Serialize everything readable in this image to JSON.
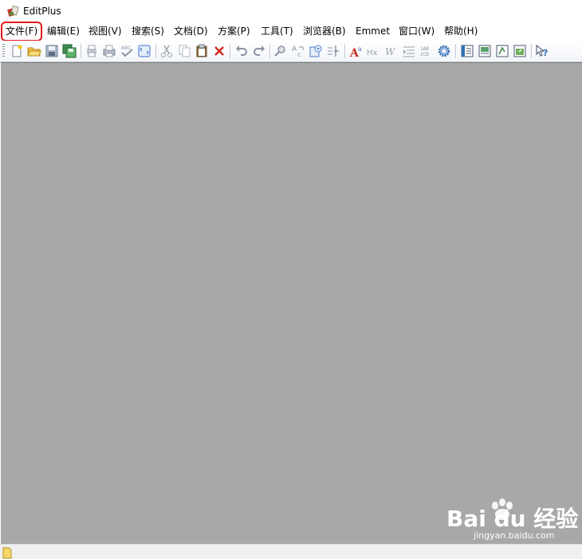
{
  "window": {
    "title": "EditPlus"
  },
  "menu": {
    "items": [
      {
        "label": "文件(F)"
      },
      {
        "label": "编辑(E)"
      },
      {
        "label": "视图(V)"
      },
      {
        "label": "搜索(S)"
      },
      {
        "label": "文档(D)"
      },
      {
        "label": "方案(P)"
      },
      {
        "label": "工具(T)"
      },
      {
        "label": "浏览器(B)"
      },
      {
        "label": "Emmet"
      },
      {
        "label": "窗口(W)"
      },
      {
        "label": "帮助(H)"
      }
    ],
    "highlighted_index": 0,
    "highlight_color": "#e21b1b"
  },
  "toolbar": {
    "buttons": [
      "new-file-icon",
      "open-folder-icon",
      "save-icon",
      "save-all-icon",
      "print-preview-icon",
      "print-icon",
      "spell-check-icon",
      "browser-preview-icon",
      "cut-icon",
      "copy-icon",
      "paste-icon",
      "delete-icon",
      "undo-icon",
      "redo-icon",
      "find-icon",
      "replace-icon",
      "goto-icon",
      "line-number-icon",
      "font-icon",
      "hex-icon",
      "word-wrap-icon",
      "indent-icon",
      "column-icon",
      "settings-icon",
      "doc-selector-icon",
      "output-window-icon",
      "cliptext-icon",
      "directory-window-icon",
      "help-icon"
    ]
  },
  "workarea": {
    "background": "#a8a8a8"
  },
  "watermark": {
    "text": "Bai du 经验",
    "url": "jingyan.baidu.com"
  }
}
